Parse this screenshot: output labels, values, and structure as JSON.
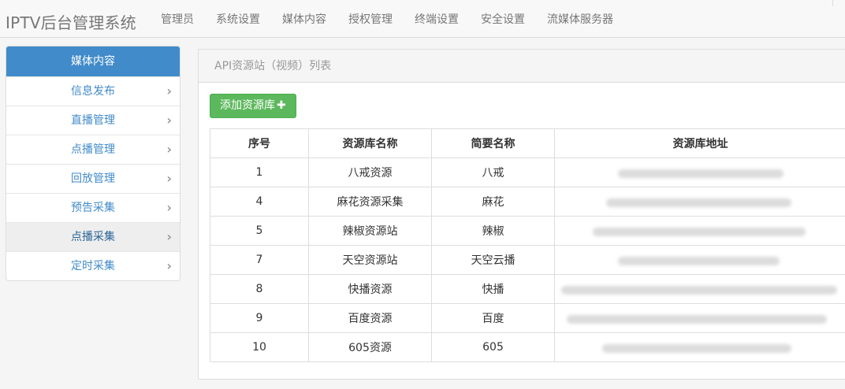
{
  "brand": "IPTV后台管理系统",
  "nav": [
    "管理员",
    "系统设置",
    "媒体内容",
    "授权管理",
    "终端设置",
    "安全设置",
    "流媒体服务器"
  ],
  "sidebar": {
    "title": "媒体内容",
    "items": [
      {
        "label": "信息发布",
        "active": false
      },
      {
        "label": "直播管理",
        "active": false
      },
      {
        "label": "点播管理",
        "active": false
      },
      {
        "label": "回放管理",
        "active": false
      },
      {
        "label": "预告采集",
        "active": false
      },
      {
        "label": "点播采集",
        "active": true
      },
      {
        "label": "定时采集",
        "active": false
      }
    ]
  },
  "panel": {
    "title": "API资源站（视频）列表",
    "add_button": "添加资源库",
    "add_icon": "plus-icon"
  },
  "table": {
    "headers": [
      "序号",
      "资源库名称",
      "简要名称",
      "资源库地址"
    ],
    "rows": [
      [
        "1",
        "八戒资源",
        "八戒",
        ""
      ],
      [
        "4",
        "麻花资源采集",
        "麻花",
        ""
      ],
      [
        "5",
        "辣椒资源站",
        "辣椒",
        ""
      ],
      [
        "7",
        "天空资源站",
        "天空云播",
        ""
      ],
      [
        "8",
        "快播资源",
        "快播",
        ""
      ],
      [
        "9",
        "百度资源",
        "百度",
        ""
      ],
      [
        "10",
        "605资源",
        "605",
        ""
      ]
    ]
  },
  "colors": {
    "sidebar_header": "#428bca",
    "link": "#428bca",
    "add_button": "#5cb85c"
  }
}
